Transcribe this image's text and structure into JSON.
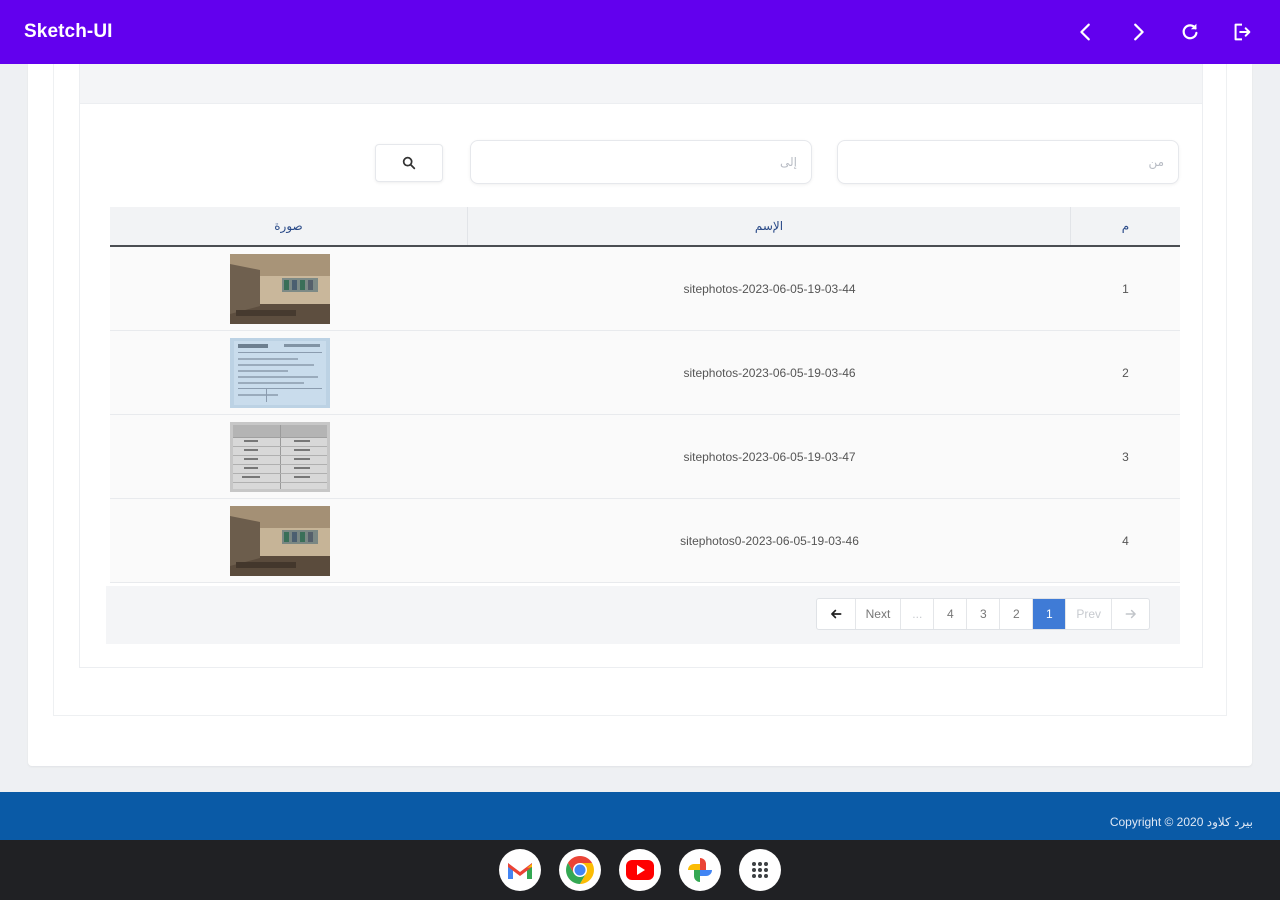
{
  "appbar": {
    "title": "Sketch-UI",
    "actions": [
      {
        "name": "back-icon"
      },
      {
        "name": "forward-icon"
      },
      {
        "name": "refresh-icon"
      },
      {
        "name": "logout-icon"
      }
    ],
    "background": "#6200ee"
  },
  "filters": {
    "from_placeholder": "من",
    "to_placeholder": "إلى",
    "search_icon": "search-icon"
  },
  "table": {
    "headers": {
      "image": "صورة",
      "name": "الإسم",
      "number": "م"
    },
    "rows": [
      {
        "number": "1",
        "name": "sitephotos-2023-06-05-19-03-44",
        "thumb": "room-photo"
      },
      {
        "number": "2",
        "name": "sitephotos-2023-06-05-19-03-46",
        "thumb": "document-photo"
      },
      {
        "number": "3",
        "name": "sitephotos-2023-06-05-19-03-47",
        "thumb": "table-photo"
      },
      {
        "number": "4",
        "name": "sitephotos0-2023-06-05-19-03-46",
        "thumb": "room-photo"
      }
    ]
  },
  "pagination": {
    "prev_arrow": "arrow-left-icon",
    "next_label": "Next",
    "ellipsis": "...",
    "pages": [
      "4",
      "3",
      "2",
      "1"
    ],
    "active_page": "1",
    "prev_label": "Prev",
    "next_arrow": "arrow-right-icon",
    "active_color": "#3f7bd6"
  },
  "footer": {
    "copyright": "Copyright © 2020 بيرد كلاود",
    "background": "#0a5aa6"
  },
  "shelf": {
    "apps": [
      "gmail-icon",
      "chrome-icon",
      "youtube-icon",
      "google-photos-icon",
      "app-launcher-icon"
    ]
  }
}
